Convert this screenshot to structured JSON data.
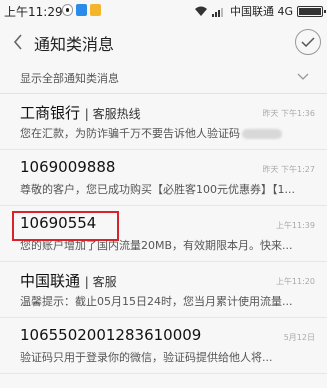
{
  "status": {
    "time": "上午11:29",
    "carrier": "中国联通 4G"
  },
  "header": {
    "title": "通知类消息"
  },
  "filter": {
    "label": "显示全部通知类消息"
  },
  "messages": [
    {
      "sender": "工商银行",
      "sender_sub": "| 客服热线",
      "time": "昨天 下午1:36",
      "preview": "您在汇款，为防诈骗千万不要告诉他人验证码"
    },
    {
      "sender": "1069009888",
      "sender_sub": "",
      "time": "昨天 下午1:27",
      "preview": "尊敬的客户，您已成功购买【必胜客100元优惠券】【1..."
    },
    {
      "sender": "10690554",
      "sender_sub": "",
      "time": "上午11:39",
      "preview": "您的账户增加了国内流量20MB，有效期限本月。快来..."
    },
    {
      "sender": "中国联通",
      "sender_sub": "| 客服",
      "time": "上午11:20",
      "preview": "温馨提示：截止05月15日24时，您当月累计使用流量..."
    },
    {
      "sender": "1065502001283610009",
      "sender_sub": "",
      "time": "5月12日",
      "preview": "验证码只用于登录你的微信，验证码提供给他人将..."
    }
  ]
}
